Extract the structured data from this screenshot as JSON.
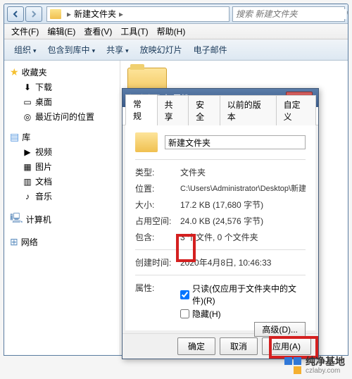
{
  "explorer": {
    "breadcrumb": "新建文件夹",
    "search_placeholder": "搜索 新建文件夹",
    "menu": [
      "文件(F)",
      "编辑(E)",
      "查看(V)",
      "工具(T)",
      "帮助(H)"
    ],
    "toolbar": [
      "组织",
      "包含到库中",
      "共享",
      "放映幻灯片",
      "电子邮件"
    ]
  },
  "sidebar": {
    "favorites": {
      "label": "收藏夹",
      "items": [
        "下载",
        "桌面",
        "最近访问的位置"
      ]
    },
    "libraries": {
      "label": "库",
      "items": [
        "视频",
        "图片",
        "文档",
        "音乐"
      ]
    },
    "computer": {
      "label": "计算机"
    },
    "network": {
      "label": "网络"
    }
  },
  "dialog": {
    "title": "新建文件夹 属性",
    "tabs": [
      "常规",
      "共享",
      "安全",
      "以前的版本",
      "自定义"
    ],
    "folder_name": "新建文件夹",
    "props": {
      "type": {
        "label": "类型:",
        "value": "文件夹"
      },
      "location": {
        "label": "位置:",
        "value": "C:\\Users\\Administrator\\Desktop\\新建文件夹"
      },
      "size": {
        "label": "大小:",
        "value": "17.2 KB (17,680 字节)"
      },
      "sizeondisk": {
        "label": "占用空间:",
        "value": "24.0 KB (24,576 字节)"
      },
      "contains": {
        "label": "包含:",
        "value": "3 个文件, 0 个文件夹"
      },
      "created": {
        "label": "创建时间:",
        "value": "2020年4月8日, 10:46:33"
      }
    },
    "attr_label": "属性:",
    "readonly": "只读(仅应用于文件夹中的文件)(R)",
    "hidden": "隐藏(H)",
    "advanced": "高级(D)...",
    "buttons": {
      "ok": "确定",
      "cancel": "取消",
      "apply": "应用(A)"
    }
  },
  "watermark": {
    "name": "纯净基地",
    "url": "czlaby.com"
  }
}
